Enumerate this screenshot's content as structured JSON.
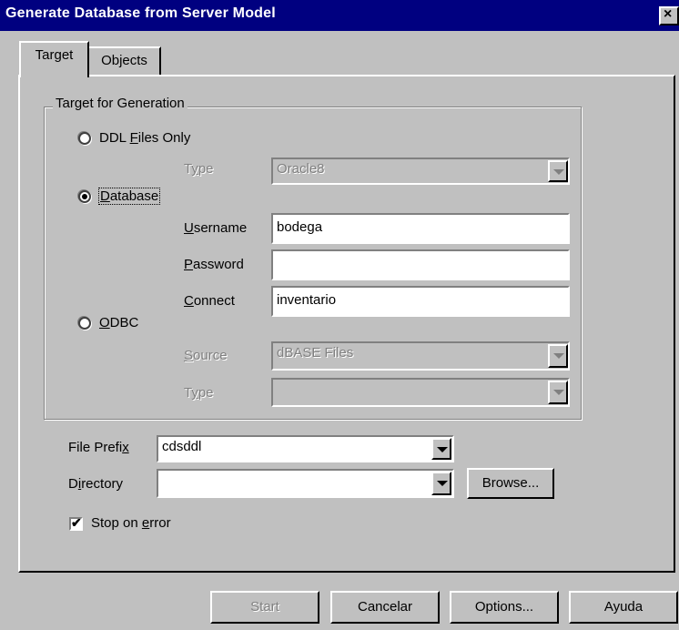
{
  "window": {
    "title": "Generate Database from Server Model",
    "close_glyph": "×"
  },
  "tabs": [
    {
      "label": "Target"
    },
    {
      "label": "Objects"
    }
  ],
  "group": {
    "label": "Target for Generation"
  },
  "ddl_option": {
    "pre": "DDL ",
    "key": "F",
    "post": "iles Only",
    "selected": false
  },
  "ddl_type": {
    "label_pre": "T",
    "label_key": "y",
    "label_post": "pe",
    "value": "Oracle8"
  },
  "database_option": {
    "key": "D",
    "post": "atabase",
    "selected": true
  },
  "username": {
    "key": "U",
    "post": "sername",
    "value": "bodega"
  },
  "password": {
    "key": "P",
    "post": "assword",
    "value": ""
  },
  "connect": {
    "key": "C",
    "post": "onnect",
    "value": "inventario"
  },
  "odbc_option": {
    "key": "O",
    "post": "DBC",
    "selected": false
  },
  "odbc_source": {
    "key": "S",
    "post": "ource",
    "value": "dBASE Files"
  },
  "odbc_type": {
    "label_pre": "T",
    "label_key": "y",
    "label_post": "pe",
    "value": ""
  },
  "file_prefix": {
    "pre": "File Prefi",
    "key": "x",
    "value": "cdsddl"
  },
  "directory": {
    "pre": "D",
    "key": "i",
    "post": "rectory",
    "value": ""
  },
  "browse_label": "Browse...",
  "stop_on_error": {
    "pre": "Stop on ",
    "key": "e",
    "post": "rror",
    "checked": true,
    "check_glyph": "✔"
  },
  "buttons": {
    "start": "Start",
    "cancel": "Cancelar",
    "options": "Options...",
    "help": "Ayuda"
  }
}
